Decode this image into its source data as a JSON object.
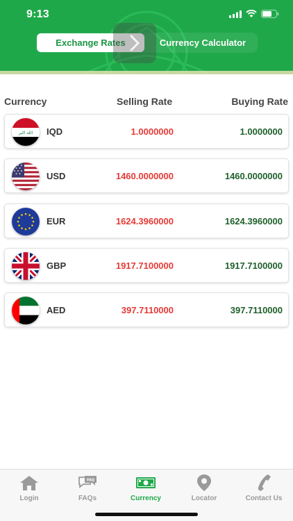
{
  "status_bar": {
    "time": "9:13"
  },
  "segmented": {
    "active_tab": "Exchange Rates",
    "inactive_tab": "Currency Calculator"
  },
  "table": {
    "headers": {
      "currency": "Currency",
      "selling": "Selling Rate",
      "buying": "Buying Rate"
    },
    "rows": [
      {
        "code": "IQD",
        "flag": "iraq-flag",
        "selling": "1.0000000",
        "buying": "1.0000000"
      },
      {
        "code": "USD",
        "flag": "usa-flag",
        "selling": "1460.0000000",
        "buying": "1460.0000000"
      },
      {
        "code": "EUR",
        "flag": "eu-flag",
        "selling": "1624.3960000",
        "buying": "1624.3960000"
      },
      {
        "code": "GBP",
        "flag": "uk-flag",
        "selling": "1917.7100000",
        "buying": "1917.7100000"
      },
      {
        "code": "AED",
        "flag": "uae-flag",
        "selling": "397.7110000",
        "buying": "397.7110000"
      }
    ]
  },
  "tabbar": {
    "items": [
      {
        "label": "Login",
        "icon": "home-icon"
      },
      {
        "label": "FAQs",
        "icon": "faq-icon"
      },
      {
        "label": "Currency",
        "icon": "currency-icon"
      },
      {
        "label": "Locator",
        "icon": "location-pin-icon"
      },
      {
        "label": "Contact Us",
        "icon": "phone-icon"
      }
    ],
    "active": "Currency"
  },
  "flag_texts": {
    "iraq": "الله اكبر"
  },
  "colors": {
    "brand_green": "#1fa84a",
    "selling_red": "#e53935",
    "buying_green": "#1e5f2a"
  }
}
